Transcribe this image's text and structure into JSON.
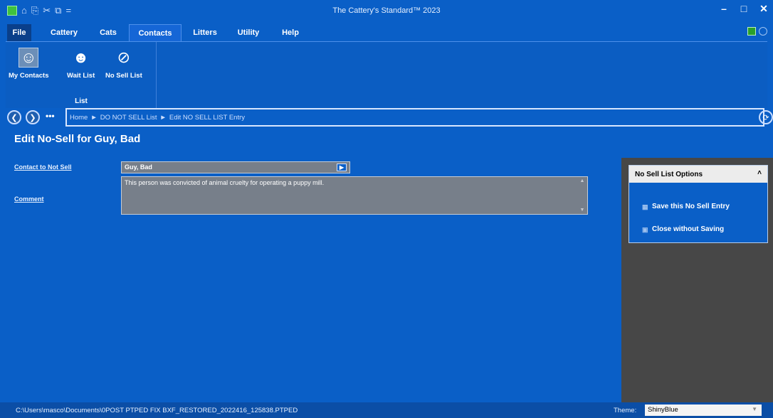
{
  "window": {
    "title": "The Cattery's Standard™ 2023",
    "minimize": "–",
    "maximize": "□",
    "close": "✕"
  },
  "quick_access": {
    "items": [
      "⌂",
      "⎘",
      "✂",
      "⧉",
      "="
    ]
  },
  "menu": {
    "tabs": [
      "File",
      "Cattery",
      "Cats",
      "Contacts",
      "Litters",
      "Utility",
      "Help"
    ],
    "active": "Contacts"
  },
  "ribbon": {
    "buttons": [
      {
        "label": "My Contacts",
        "icon": "contacts-icon"
      },
      {
        "label": "Wait List",
        "icon": "wait-list-icon"
      },
      {
        "label": "No Sell List",
        "icon": "no-sell-list-icon"
      }
    ],
    "group_label": "List"
  },
  "nav": {
    "more": "•••",
    "breadcrumb": [
      "Home",
      "DO NOT SELL List",
      "Edit NO SELL LIST Entry"
    ],
    "separator": "►"
  },
  "form": {
    "title": "Edit No-Sell for Guy, Bad",
    "contact_label": "Contact to Not Sell",
    "contact_value": "Guy, Bad",
    "comment_label": "Comment",
    "comment_value": "This person was convicted of animal cruelty for operating a puppy mill."
  },
  "options_panel": {
    "title": "No Sell List Options",
    "save_label": "Save this No Sell Entry",
    "close_label": "Close without Saving"
  },
  "status": {
    "path": "C:\\Users\\masco\\Documents\\0POST PTPED FIX BXF_RESTORED_2022416_125838.PTPED",
    "theme_label": "Theme:",
    "theme_value": "ShinyBlue"
  },
  "colors": {
    "accent": "#0a5fc7",
    "side_panel": "#474747",
    "field_bg": "#777f8a"
  }
}
